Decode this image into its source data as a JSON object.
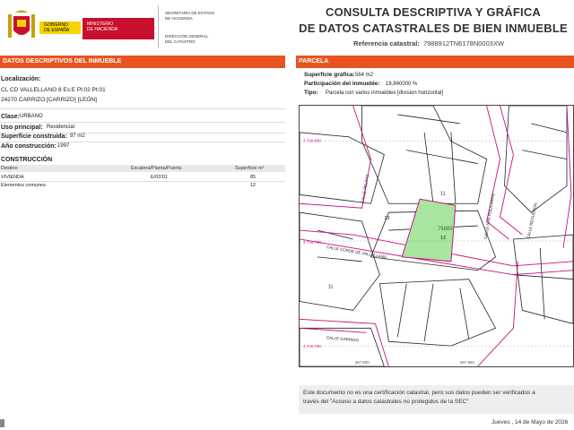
{
  "header": {
    "gov_line1": "GOBIERNO",
    "gov_line2": "DE ESPAÑA",
    "min_line1": "MINISTERIO",
    "min_line2": "DE HACIENDA",
    "sec_line1": "SECRETARÍA DE ESTADO",
    "sec_line2": "DE HACIENDA",
    "dir_line1": "DIRECCIÓN GENERAL",
    "dir_line2": "DEL CATASTRO",
    "title_line1": "CONSULTA DESCRIPTIVA Y GRÁFICA",
    "title_line2": "DE DATOS CATASTRALES DE BIEN INMUEBLE",
    "ref_label": "Referencia catastral:",
    "ref_value": "7988912TN6178N0003XW"
  },
  "left": {
    "section_title": "DATOS DESCRIPTIVOS DEL INMUEBLE",
    "loc_label": "Localización:",
    "loc_line1": "CL CD VALLELLANO 8 Es:E Pl:02 Pt:01",
    "loc_line2": "24270 CARRIZO [CARRIZO] [LEÓN]",
    "clase_label": "Clase:",
    "clase_value": "URBANO",
    "uso_label": "Uso principal:",
    "uso_value": "Residencial",
    "sup_label": "Superficie construida:",
    "sup_value": "97 m2",
    "anio_label": "Año construcción:",
    "anio_value": "1997",
    "cons_title": "CONSTRUCCIÓN",
    "col_destino": "Destino",
    "col_escalera": "Escalera/Planta/Puerta",
    "col_superficie": "Superficie m²",
    "rows": [
      {
        "destino": "VIVIENDA",
        "escalera": "E/02/01",
        "superficie": "85"
      },
      {
        "destino": "Elementos comunes",
        "escalera": "",
        "superficie": "12"
      }
    ]
  },
  "right": {
    "section_title": "PARCELA",
    "supg_label": "Superficie gráfica:",
    "supg_value": "564 m2",
    "part_label": "Participación del inmueble:",
    "part_value": "18,840000 %",
    "tipo_label": "Tipo:",
    "tipo_value": "Parcela con varios inmuebles [division horizontal]"
  },
  "map": {
    "streets": [
      "CALLE PELAYO",
      "CALLE CONDE DE VALLELLANO",
      "CALLE REGUERON",
      "CALLE SAN POLICARPO",
      "CALLE GARRIDO"
    ],
    "parcel_label": "79889",
    "parcel_numbers": [
      "11",
      "13",
      "12",
      "11"
    ],
    "elevations": [
      "4.716.800",
      "4.716.750",
      "4.716.700"
    ],
    "easting_top": "267.800",
    "easting_bottom": "267.850",
    "accent": "#c8107e",
    "parcel_fill": "#a8e6a0"
  },
  "footer": {
    "notice_line1": "Este documento no es una certificación catastral, pero sus datos pueden ser verificados a",
    "notice_line2": "través del \"Acceso a datos catastrales no protegidos de la SEC\"",
    "date": "Jueves , 14 de Mayo de 2026"
  }
}
